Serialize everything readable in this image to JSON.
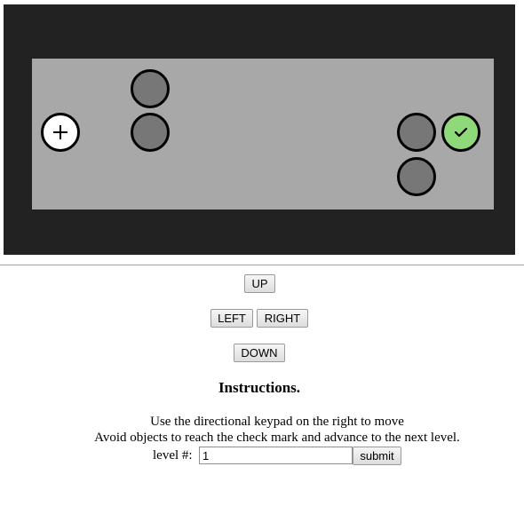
{
  "game": {
    "frame_color": "#222222",
    "board_color": "#a8a8a8",
    "obstacle_color": "#777777",
    "player_icon": "plus-icon",
    "goal_icon": "checkmark-icon",
    "goal_color": "#8fd97a"
  },
  "controls": {
    "up_label": "UP",
    "left_label": "LEFT",
    "right_label": "RIGHT",
    "down_label": "DOWN"
  },
  "instructions": {
    "title": "Instructions.",
    "line1": "Use the directional keypad on the right to move",
    "line2": "Avoid objects to reach the check mark and advance to the next level."
  },
  "level_form": {
    "label": "level #:",
    "value": "1",
    "submit_label": "submit"
  }
}
